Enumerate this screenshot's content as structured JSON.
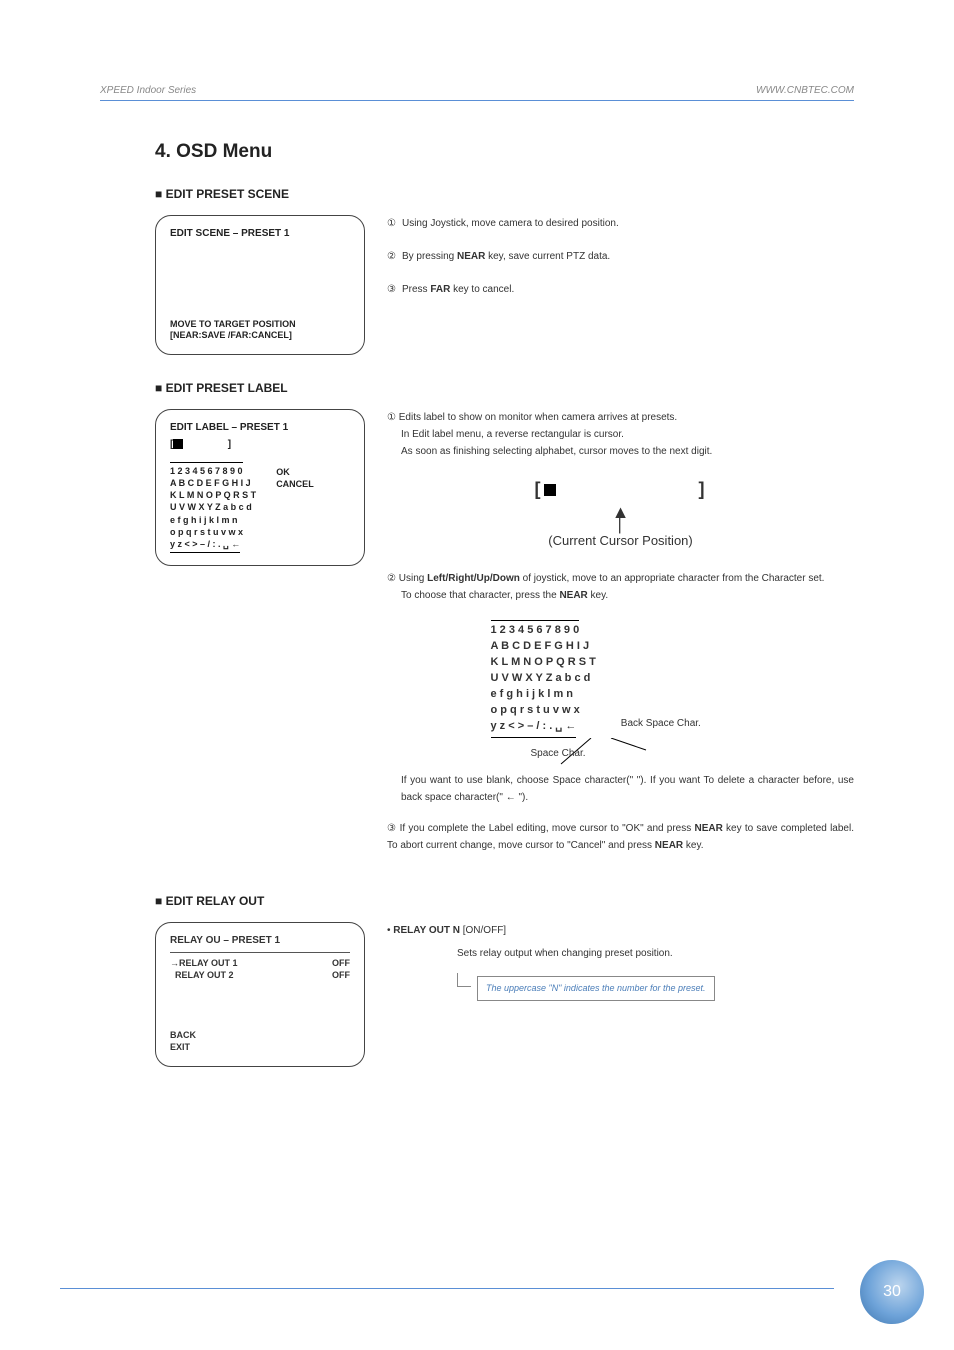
{
  "header": {
    "left": "XPEED Indoor Series",
    "right": "WWW.CNBTEC.COM"
  },
  "title": "4. OSD Menu",
  "sections": {
    "scene": {
      "heading": "EDIT PRESET SCENE",
      "osd_title": "EDIT SCENE – PRESET 1",
      "osd_footer1": "MOVE TO TARGET POSITION",
      "osd_footer2": "[NEAR:SAVE   /FAR:CANCEL]",
      "step1_num": "①",
      "step1": "Using Joystick, move camera to desired position.",
      "step2_num": "②",
      "step2_a": "By pressing ",
      "step2_b": "NEAR",
      "step2_c": " key, save current PTZ data.",
      "step3_num": "③",
      "step3_a": "Press ",
      "step3_b": "FAR",
      "step3_c": " key to cancel."
    },
    "label": {
      "heading": "EDIT PRESET LABEL",
      "osd_title": "EDIT LABEL – PRESET 1",
      "charset": {
        "l1": "1 2 3 4 5 6 7 8 9 0",
        "l2": "A B C D E F G H I J",
        "l3": "K L M N O P Q R S T",
        "l4": "U V W X Y Z a b c d",
        "l5": "e f g h i j k l m n",
        "l6": "o p q r s t u v w x",
        "l7": "y z < > – / : . ␣ ←"
      },
      "ok": "OK",
      "cancel": "CANCEL",
      "step1_num": "①",
      "step1_a": "Edits label to show on monitor when camera arrives at presets.",
      "step1_b": "In Edit label menu, a reverse rectangular is cursor.",
      "step1_c": "As soon as finishing selecting alphabet, cursor moves to the next digit.",
      "cursor_fig_label": "(Current Cursor Position)",
      "step2_num": "②",
      "step2_a": "Using ",
      "step2_b": "Left/Right/Up/Down",
      "step2_c": " of joystick, move to an appropriate character from the Character set.",
      "step2_d": "To choose that character, press the ",
      "step2_e": "NEAR",
      "step2_f": " key.",
      "bs_label": "Back Space Char.",
      "sp_label": "Space Char.",
      "blank_note": "If you want to use blank, choose Space character(\" \"). If you want To delete a character before, use back space character(\" ← \").",
      "step3_num": "③",
      "step3_a": "If you complete the Label editing, move cursor to \"OK\" and press ",
      "step3_b": "NEAR",
      "step3_c": " key to save completed label. To abort current change, move cursor to \"Cancel\" and press ",
      "step3_d": "NEAR",
      "step3_e": " key."
    },
    "relay": {
      "heading": "EDIT RELAY OUT",
      "osd_title": "RELAY OU – PRESET 1",
      "row1_label": "→RELAY OUT 1",
      "row1_val": "OFF",
      "row2_label": "  RELAY OUT 2",
      "row2_val": "OFF",
      "back": "BACK",
      "exit": "EXIT",
      "bullet": "• ",
      "desc_title_a": "RELAY OUT N ",
      "desc_title_b": "[ON/OFF]",
      "desc_body": "Sets relay output when changing preset position.",
      "note": "The uppercase \"N\" indicates the number for the preset."
    }
  },
  "page_number": "30"
}
